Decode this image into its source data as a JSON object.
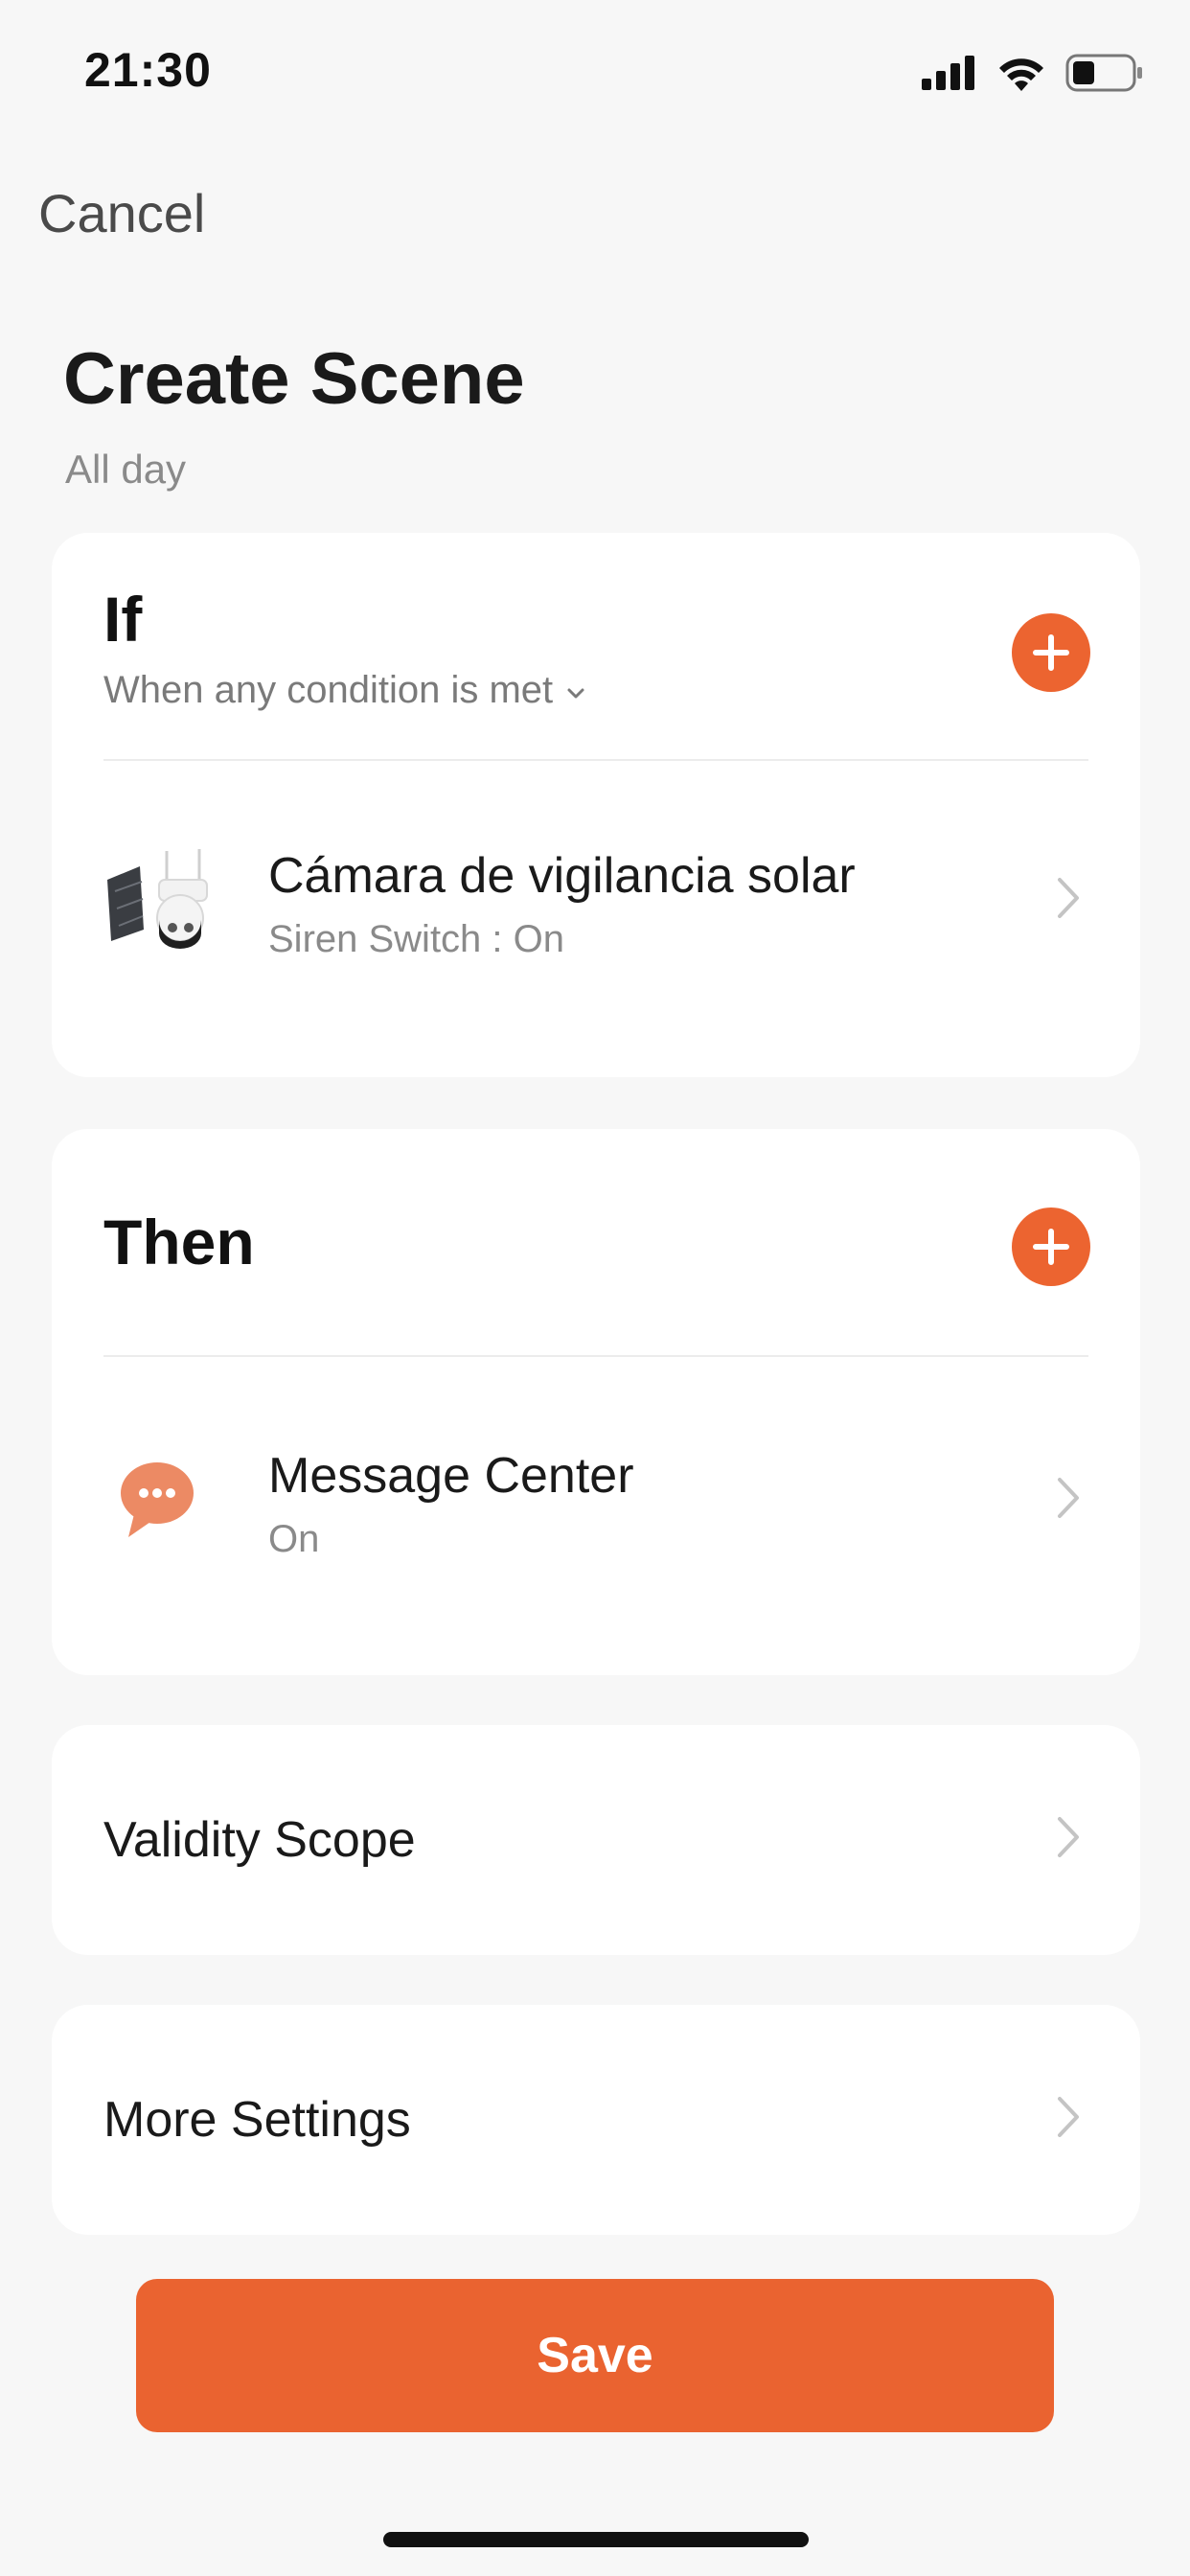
{
  "status_bar": {
    "time": "21:30"
  },
  "nav": {
    "cancel_label": "Cancel"
  },
  "header": {
    "title": "Create Scene",
    "subtitle": "All day"
  },
  "if_section": {
    "title": "If",
    "condition_mode": "When any condition is met",
    "conditions": [
      {
        "device_name": "Cámara de vigilancia solar",
        "detail": "Siren Switch : On",
        "icon": "solar-camera-icon"
      }
    ]
  },
  "then_section": {
    "title": "Then",
    "actions": [
      {
        "name": "Message Center",
        "detail": "On",
        "icon": "chat-bubble-icon"
      }
    ]
  },
  "settings": {
    "validity_scope": "Validity Scope",
    "more_settings": "More Settings"
  },
  "save_label": "Save",
  "colors": {
    "accent": "#ec6430",
    "background": "#f7f7f7",
    "card": "#ffffff"
  }
}
